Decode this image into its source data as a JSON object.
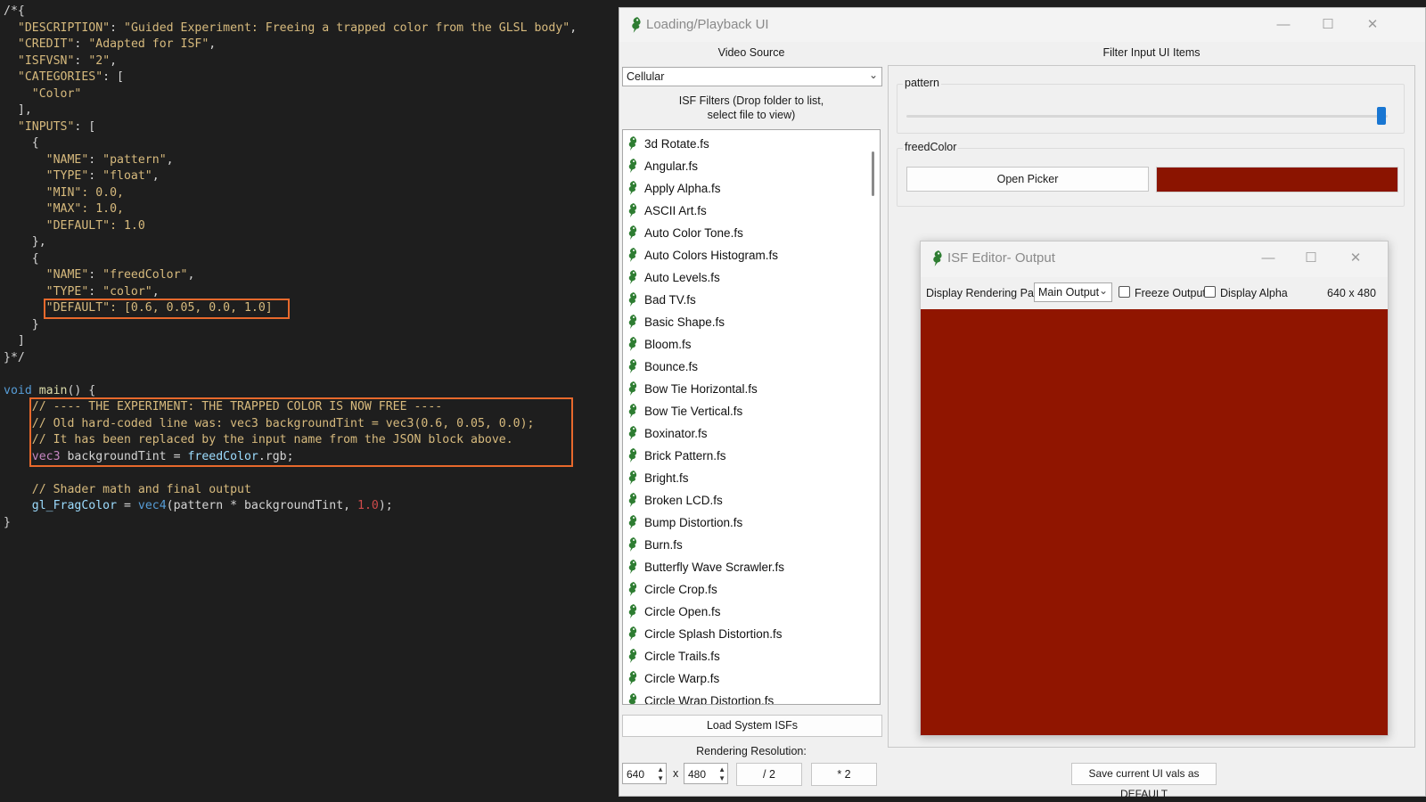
{
  "editor": {
    "lines": [
      [
        {
          "t": "/*{",
          "c": "c-punc"
        }
      ],
      [
        {
          "t": "  ",
          "c": "c-punc"
        },
        {
          "t": "\"DESCRIPTION\"",
          "c": "c-str"
        },
        {
          "t": ": ",
          "c": "c-punc"
        },
        {
          "t": "\"Guided Experiment: Freeing a trapped color from the GLSL body\"",
          "c": "c-str"
        },
        {
          "t": ",",
          "c": "c-punc"
        }
      ],
      [
        {
          "t": "  ",
          "c": "c-punc"
        },
        {
          "t": "\"CREDIT\"",
          "c": "c-str"
        },
        {
          "t": ": ",
          "c": "c-punc"
        },
        {
          "t": "\"Adapted for ISF\"",
          "c": "c-str"
        },
        {
          "t": ",",
          "c": "c-punc"
        }
      ],
      [
        {
          "t": "  ",
          "c": "c-punc"
        },
        {
          "t": "\"ISFVSN\"",
          "c": "c-str"
        },
        {
          "t": ": ",
          "c": "c-punc"
        },
        {
          "t": "\"2\"",
          "c": "c-str"
        },
        {
          "t": ",",
          "c": "c-punc"
        }
      ],
      [
        {
          "t": "  ",
          "c": "c-punc"
        },
        {
          "t": "\"CATEGORIES\"",
          "c": "c-str"
        },
        {
          "t": ": [",
          "c": "c-punc"
        }
      ],
      [
        {
          "t": "    ",
          "c": "c-punc"
        },
        {
          "t": "\"Color\"",
          "c": "c-str"
        }
      ],
      [
        {
          "t": "  ],",
          "c": "c-punc"
        }
      ],
      [
        {
          "t": "  ",
          "c": "c-punc"
        },
        {
          "t": "\"INPUTS\"",
          "c": "c-str"
        },
        {
          "t": ": [",
          "c": "c-punc"
        }
      ],
      [
        {
          "t": "    {",
          "c": "c-punc"
        }
      ],
      [
        {
          "t": "      ",
          "c": "c-punc"
        },
        {
          "t": "\"NAME\"",
          "c": "c-str"
        },
        {
          "t": ": ",
          "c": "c-punc"
        },
        {
          "t": "\"pattern\"",
          "c": "c-str"
        },
        {
          "t": ",",
          "c": "c-punc"
        }
      ],
      [
        {
          "t": "      ",
          "c": "c-punc"
        },
        {
          "t": "\"TYPE\"",
          "c": "c-str"
        },
        {
          "t": ": ",
          "c": "c-punc"
        },
        {
          "t": "\"float\"",
          "c": "c-str"
        },
        {
          "t": ",",
          "c": "c-punc"
        }
      ],
      [
        {
          "t": "      ",
          "c": "c-punc"
        },
        {
          "t": "\"MIN\"",
          "c": "c-str"
        },
        {
          "t": ": 0.0,",
          "c": "c-str"
        }
      ],
      [
        {
          "t": "      ",
          "c": "c-punc"
        },
        {
          "t": "\"MAX\"",
          "c": "c-str"
        },
        {
          "t": ": 1.0,",
          "c": "c-str"
        }
      ],
      [
        {
          "t": "      ",
          "c": "c-punc"
        },
        {
          "t": "\"DEFAULT\"",
          "c": "c-str"
        },
        {
          "t": ": 1.0",
          "c": "c-str"
        }
      ],
      [
        {
          "t": "    },",
          "c": "c-punc"
        }
      ],
      [
        {
          "t": "    {",
          "c": "c-punc"
        }
      ],
      [
        {
          "t": "      ",
          "c": "c-punc"
        },
        {
          "t": "\"NAME\"",
          "c": "c-str"
        },
        {
          "t": ": ",
          "c": "c-punc"
        },
        {
          "t": "\"freedColor\"",
          "c": "c-str"
        },
        {
          "t": ",",
          "c": "c-punc"
        }
      ],
      [
        {
          "t": "      ",
          "c": "c-punc"
        },
        {
          "t": "\"TYPE\"",
          "c": "c-str"
        },
        {
          "t": ": ",
          "c": "c-punc"
        },
        {
          "t": "\"color\"",
          "c": "c-str"
        },
        {
          "t": ",",
          "c": "c-punc"
        }
      ],
      [
        {
          "t": "      ",
          "c": "c-punc"
        },
        {
          "t": "\"DEFAULT\"",
          "c": "c-str"
        },
        {
          "t": ": [0.6, 0.05, 0.0, 1.0]",
          "c": "c-str"
        }
      ],
      [
        {
          "t": "    }",
          "c": "c-punc"
        }
      ],
      [
        {
          "t": "  ]",
          "c": "c-punc"
        }
      ],
      [
        {
          "t": "}*/",
          "c": "c-punc"
        }
      ],
      [
        {
          "t": "",
          "c": "c-punc"
        }
      ],
      [
        {
          "t": "void ",
          "c": "c-key"
        },
        {
          "t": "main",
          "c": "c-func"
        },
        {
          "t": "() {",
          "c": "c-punc"
        }
      ],
      [
        {
          "t": "    // ---- THE EXPERIMENT: THE TRAPPED COLOR IS NOW FREE ----",
          "c": "c-comment"
        }
      ],
      [
        {
          "t": "    // Old hard-coded line was: vec3 backgroundTint = vec3(0.6, 0.05, 0.0);",
          "c": "c-comment"
        }
      ],
      [
        {
          "t": "    // It has been replaced by the input name from the JSON block above.",
          "c": "c-comment"
        }
      ],
      [
        {
          "t": "    ",
          "c": "c-punc"
        },
        {
          "t": "vec3",
          "c": "c-type"
        },
        {
          "t": " backgroundTint = ",
          "c": "c-id"
        },
        {
          "t": "freedColor",
          "c": "c-glob"
        },
        {
          "t": ".rgb;",
          "c": "c-id"
        }
      ],
      [
        {
          "t": "",
          "c": "c-punc"
        }
      ],
      [
        {
          "t": "    // Shader math and final output",
          "c": "c-comment"
        }
      ],
      [
        {
          "t": "    ",
          "c": "c-punc"
        },
        {
          "t": "gl_FragColor",
          "c": "c-glob"
        },
        {
          "t": " = ",
          "c": "c-id"
        },
        {
          "t": "vec4",
          "c": "c-key"
        },
        {
          "t": "(pattern * backgroundTint, ",
          "c": "c-id"
        },
        {
          "t": "1.0",
          "c": "c-num"
        },
        {
          "t": ");",
          "c": "c-id"
        }
      ],
      [
        {
          "t": "}",
          "c": "c-punc"
        }
      ]
    ]
  },
  "main_window": {
    "title": "Loading/Playback UI",
    "video_source_label": "Video Source",
    "video_source_value": "Cellular",
    "filters_label_1": "ISF Filters (Drop folder to list,",
    "filters_label_2": "select file to view)",
    "filter_input_label": "Filter Input UI Items",
    "filters": [
      "3d Rotate.fs",
      "Angular.fs",
      "Apply Alpha.fs",
      "ASCII Art.fs",
      "Auto Color Tone.fs",
      "Auto Colors Histogram.fs",
      "Auto Levels.fs",
      "Bad TV.fs",
      "Basic Shape.fs",
      "Bloom.fs",
      "Bounce.fs",
      "Bow Tie Horizontal.fs",
      "Bow Tie Vertical.fs",
      "Boxinator.fs",
      "Brick Pattern.fs",
      "Bright.fs",
      "Broken LCD.fs",
      "Bump Distortion.fs",
      "Burn.fs",
      "Butterfly Wave Scrawler.fs",
      "Circle Crop.fs",
      "Circle Open.fs",
      "Circle Splash Distortion.fs",
      "Circle Trails.fs",
      "Circle Warp.fs",
      "Circle Wrap Distortion.fs"
    ],
    "load_system_label": "Load System ISFs",
    "rendering_resolution_label": "Rendering Resolution:",
    "res_width": "640",
    "res_height": "480",
    "res_x": "x",
    "half_label": "/ 2",
    "double_label": "* 2",
    "save_default_label": "Save current UI vals as DEFAULT"
  },
  "inputs": {
    "pattern_label": "pattern",
    "pattern_value": 1.0,
    "freedcolor_label": "freedColor",
    "open_picker_label": "Open Picker",
    "freedcolor_hex": "#8b1400"
  },
  "output_window": {
    "title": "ISF Editor- Output",
    "pass_label": "Display Rendering Pass:",
    "pass_value": "Main Output",
    "freeze_label": "Freeze Output",
    "alpha_label": "Display Alpha",
    "size_text": "640 x 480",
    "render_color": "#901500"
  },
  "colors": {
    "highlight_box": "#e8692c",
    "slider_handle": "#1976d2"
  }
}
